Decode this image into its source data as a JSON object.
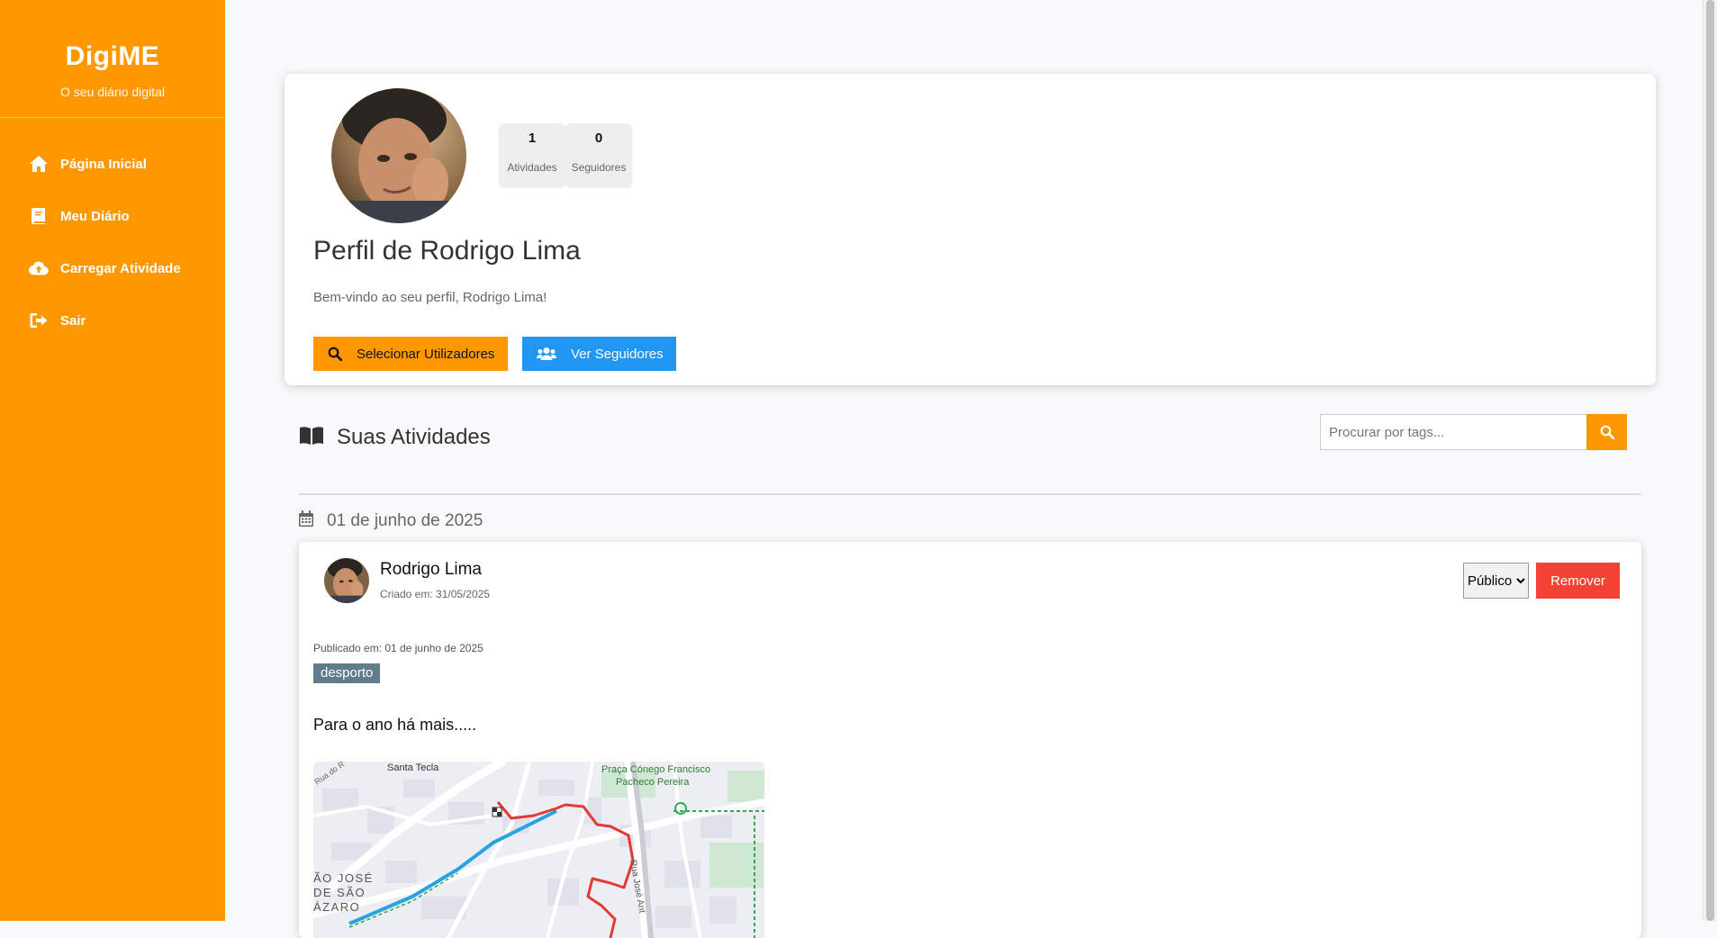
{
  "sidebar": {
    "title": "DigiME",
    "subtitle": "O seu diário digital",
    "items": [
      {
        "label": "Página Inicial",
        "icon": "home-icon"
      },
      {
        "label": "Meu Diário",
        "icon": "book-icon"
      },
      {
        "label": "Carregar Atividade",
        "icon": "cloud-upload-icon"
      },
      {
        "label": "Sair",
        "icon": "sign-out-icon"
      }
    ]
  },
  "profile": {
    "stats": [
      {
        "value": "1",
        "label": "Atividades"
      },
      {
        "value": "0",
        "label": "Seguidores"
      }
    ],
    "title": "Perfil de Rodrigo Lima",
    "welcome": "Bem-vindo ao seu perfil, Rodrigo Lima!",
    "select_users_label": "Selecionar Utilizadores",
    "view_followers_label": "Ver Seguidores"
  },
  "activities": {
    "title": "Suas Atividades",
    "search_placeholder": "Procurar por tags...",
    "date_group": "01 de junho de 2025",
    "items": [
      {
        "author": "Rodrigo Lima",
        "created": "Criado em: 31/05/2025",
        "visibility": "Público",
        "remove_label": "Remover",
        "published": "Publicado em: 01 de junho de 2025",
        "tag": "desporto",
        "description": "Para o ano há mais.....",
        "map_labels": [
          "Santa Tecla",
          "Praça Cónego Francisco",
          "Pacheco Pereira",
          "Rua do R",
          "ÃO JOSÉ",
          "DE SÃO",
          "ÁZARO",
          "Rua José Ant"
        ]
      }
    ]
  },
  "colors": {
    "accent": "#ff9800",
    "blue": "#2196f3",
    "danger": "#f44336",
    "tag": "#607d8b",
    "route": "#e53935"
  }
}
